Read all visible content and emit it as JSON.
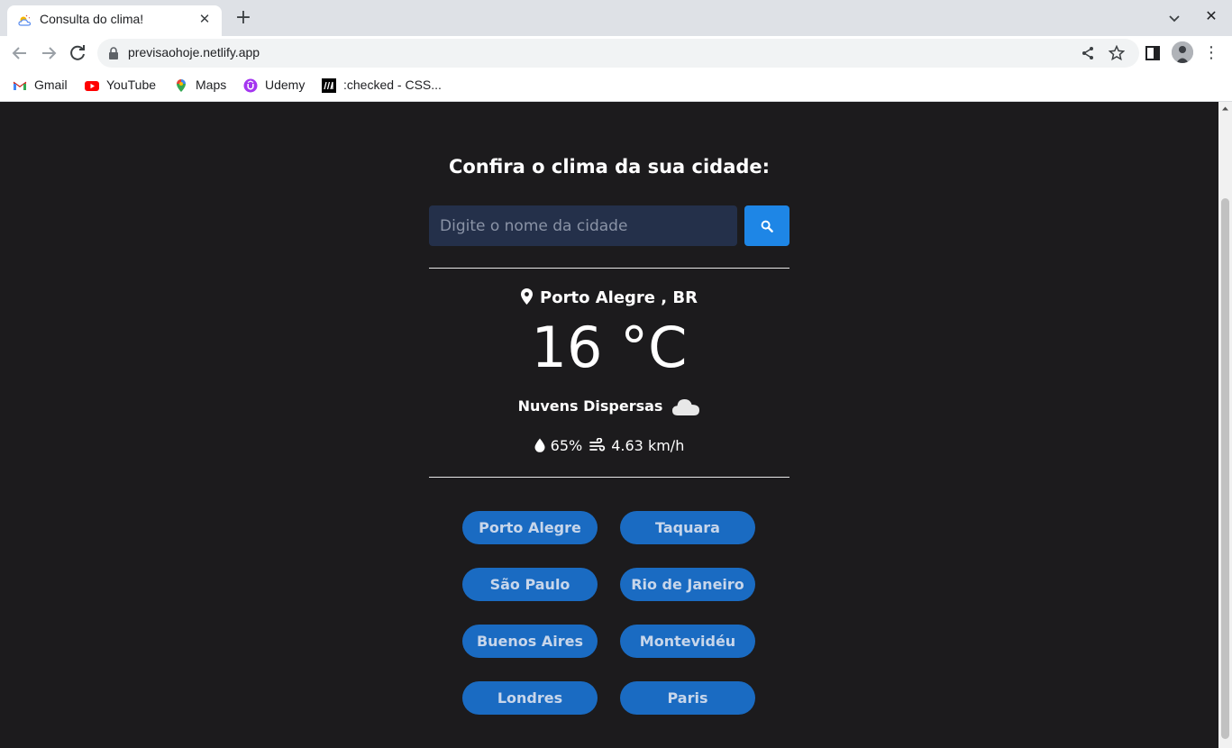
{
  "browser": {
    "tab_title": "Consulta do clima!",
    "url": "previsaohoje.netlify.app",
    "bookmarks": [
      {
        "label": "Gmail",
        "icon": "gmail-icon"
      },
      {
        "label": "YouTube",
        "icon": "youtube-icon"
      },
      {
        "label": "Maps",
        "icon": "maps-icon"
      },
      {
        "label": "Udemy",
        "icon": "udemy-icon"
      },
      {
        "label": ":checked - CSS...",
        "icon": "mdn-icon"
      }
    ]
  },
  "app": {
    "heading": "Confira o clima da sua cidade:",
    "search": {
      "placeholder": "Digite o nome da cidade",
      "value": ""
    },
    "weather": {
      "location": "Porto Alegre , BR",
      "temperature": "16 °C",
      "description": "Nuvens Dispersas",
      "humidity": "65%",
      "wind": "4.63 km/h"
    },
    "cities": [
      "Porto Alegre",
      "Taquara",
      "São Paulo",
      "Rio de Janeiro",
      "Buenos Aires",
      "Montevidéu",
      "Londres",
      "Paris"
    ],
    "colors": {
      "background": "#1c1b1d",
      "accent": "#1e86e6",
      "city_button": "#1a6bc2",
      "input_bg": "#24304a"
    }
  }
}
